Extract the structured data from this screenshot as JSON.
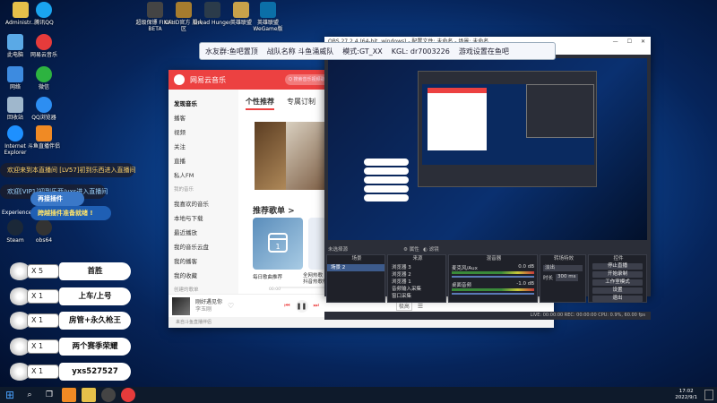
{
  "desktop": {
    "icons_left": [
      {
        "label": "Administr...",
        "icon": "user-folder-icon",
        "color": "#e7c14a"
      },
      {
        "label": "腾讯QQ",
        "icon": "qq-icon",
        "color": "#1aa4ef"
      },
      {
        "label": "此电脑",
        "icon": "computer-icon",
        "color": "#5aa9e6"
      },
      {
        "label": "网易云音乐",
        "icon": "netease-music-icon",
        "color": "#e63b3b"
      },
      {
        "label": "网络",
        "icon": "network-icon",
        "color": "#3d8be0"
      },
      {
        "label": "微信",
        "icon": "wechat-icon",
        "color": "#2db340"
      },
      {
        "label": "回收站",
        "icon": "recycle-bin-icon",
        "color": "#9fb7cc"
      },
      {
        "label": "QQ浏览器",
        "icon": "qq-browser-icon",
        "color": "#2d8ef2"
      },
      {
        "label": "Internet Explorer",
        "icon": "ie-icon",
        "color": "#1e90ff"
      },
      {
        "label": "斗鱼直播伴侣",
        "icon": "douyu-icon",
        "color": "#f08a24"
      },
      {
        "label": "Steam",
        "icon": "steam-icon",
        "color": "#1b2838"
      },
      {
        "label": "obs64",
        "icon": "obs-icon",
        "color": "#333"
      }
    ],
    "icons_top": [
      {
        "label": "超级保镖 FINAL BETA",
        "icon": "game-icon",
        "color": "#444"
      },
      {
        "label": "CFHD官方 服大区",
        "icon": "cf-icon",
        "color": "#a67c2e"
      },
      {
        "label": "Dread Hunger",
        "icon": "dread-hunger-icon",
        "color": "#2b3b4a"
      },
      {
        "label": "英雄联盟",
        "icon": "lol-icon",
        "color": "#c8a24a"
      },
      {
        "label": "英雄联盟 WeGame版",
        "icon": "lol-wegame-icon",
        "color": "#0b6fa8"
      }
    ],
    "experience_label": "Experience"
  },
  "overlay_banner": {
    "items": [
      "水友群:鱼吧置顶",
      "战队名称 斗鱼涌威队",
      "模式:GT_XX",
      "KGL: dr7003226",
      "游戏设置在鱼吧"
    ]
  },
  "chat": [
    {
      "text": "欢迎来到本直播间 [LV57]初到乐西进入直播间",
      "bg": "rgba(30,30,40,.75)",
      "color": "#ffd36a"
    },
    {
      "text": "欢迎[VIP1]初到乐西/yxs进入直播间",
      "bg": "rgba(30,30,40,.75)",
      "color": "#9fd6ff"
    },
    {
      "text": "再接插件",
      "bg": "#3a78c8",
      "color": "#fff"
    },
    {
      "text": "跨越插件准备就绪 !",
      "bg": "#1f5fb4",
      "color": "#ffe46a"
    }
  ],
  "name_tags": [
    {
      "count": "X 5",
      "name": "首胜",
      "wing_color": "#ffd24a"
    },
    {
      "count": "X 1",
      "name": "上车/上号",
      "wing_color": "#7ec8ff"
    },
    {
      "count": "X 1",
      "name": "房管+永久枪王",
      "wing_color": "#ffffff"
    },
    {
      "count": "X 1",
      "name": "两个赛季荣耀",
      "wing_color": "#f0a040"
    },
    {
      "count": "X 1",
      "name": "yxs527527",
      "wing_color": "#8fdc5a"
    }
  ],
  "music": {
    "app_name": "网易云音乐",
    "search_placeholder": "Q 搜索音乐视频歌手",
    "sidebar": [
      "发现音乐",
      "播客",
      "视频",
      "关注",
      "直播",
      "私人FM"
    ],
    "sidebar_section": "我的音乐",
    "sidebar_my": [
      "我喜欢的音乐",
      "本地与下载",
      "最近播放",
      "我的音乐云盘",
      "我的播客",
      "我的收藏"
    ],
    "sidebar_playlist_title": "创建的歌单",
    "tabs": [
      "个性推荐",
      "专属订制"
    ],
    "section_title": "推荐歌单 >",
    "cards": [
      "每日歌曲推荐",
      "全网热歌 有抖音热歌榜"
    ],
    "player": {
      "title": "刚好遇见你",
      "artist": "李玉刚",
      "time_left": "00:00",
      "time_right": "03:26"
    },
    "status": "来自斗鱼直播伴侣"
  },
  "obs": {
    "title": "OBS 27.2.4 (64-bit, windows) - 配置文件: 未命名 - 场景: 未命名",
    "panels": {
      "scenes_title": "场景",
      "sources_title": "来源",
      "mixer_title": "混音器",
      "transitions_title": "转场特效",
      "controls_title": "控件"
    },
    "scene_name": "场景 2",
    "sources": [
      "浏览器 3",
      "浏览器 2",
      "浏览器 1",
      "音频输入采集",
      "窗口采集"
    ],
    "mixer": [
      {
        "name": "麦克风/Aux",
        "db": "0.0 dB"
      },
      {
        "name": "桌面音频",
        "db": "-1.0 dB"
      }
    ],
    "transition": {
      "type": "淡出",
      "duration_label": "时长",
      "duration": "300 ms"
    },
    "controls": [
      "停止直播",
      "开始录制",
      "工作室模式",
      "设置",
      "退出"
    ],
    "no_source_label": "未选择源",
    "properties_button": "属性",
    "filters_button": "滤镜",
    "status": "LIVE: 00:00:00   REC: 00:00:00   CPU: 0.9%, 60.00 fps"
  },
  "taskbar": {
    "time": "17:02",
    "date": "2022/9/1"
  }
}
